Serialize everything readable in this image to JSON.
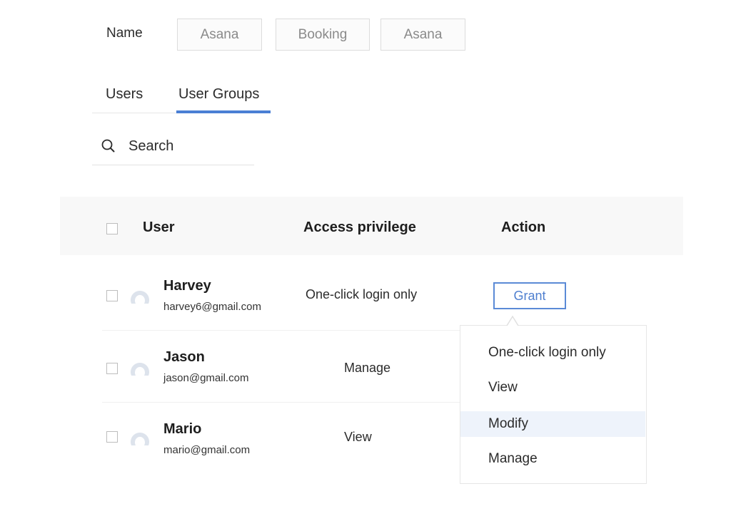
{
  "name_filter": {
    "label": "Name",
    "chips": [
      "Asana",
      "Booking",
      "Asana"
    ]
  },
  "tabs": {
    "items": [
      {
        "label": "Users",
        "active": false
      },
      {
        "label": "User Groups",
        "active": true
      }
    ],
    "active_color": "#4a7fd4"
  },
  "search": {
    "icon": "search-icon",
    "placeholder": "Search",
    "value": ""
  },
  "table": {
    "headers": {
      "user": "User",
      "access": "Access privilege",
      "action": "Action"
    },
    "rows": [
      {
        "name": "Harvey",
        "email": "harvey6@gmail.com",
        "privilege": "One-click login only",
        "avatar": "user-avatar-icon",
        "checked": false
      },
      {
        "name": "Jason",
        "email": "jason@gmail.com",
        "privilege": "Manage",
        "avatar": "user-avatar-icon",
        "checked": false
      },
      {
        "name": "Mario",
        "email": "mario@gmail.com",
        "privilege": "View",
        "avatar": "user-avatar-icon",
        "checked": false
      }
    ]
  },
  "action": {
    "grant_label": "Grant",
    "accent_color": "#5b8ad6"
  },
  "dropdown": {
    "options": [
      "One-click login only",
      "View",
      "Modify",
      "Manage"
    ],
    "highlighted": "Modify",
    "highlight_color": "#eef3fb"
  }
}
